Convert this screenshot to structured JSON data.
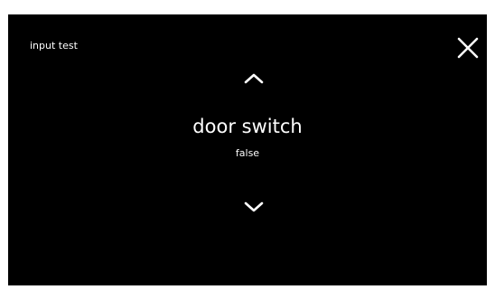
{
  "screen": {
    "title": "input test",
    "close_icon": "close-icon",
    "background_color": "#000000",
    "text_color": "#ffffff"
  },
  "selector": {
    "up_icon": "chevron-up-icon",
    "down_icon": "chevron-down-icon",
    "item_name": "door switch",
    "item_value": "false"
  }
}
